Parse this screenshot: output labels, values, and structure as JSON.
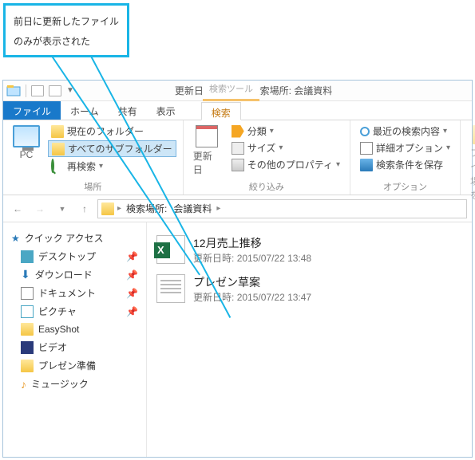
{
  "callout": {
    "line1": "前日に更新したファイル",
    "line2": "のみが表示された"
  },
  "titlebar": {
    "tools_context": "検索ツール",
    "title_prefix": "更新日時：今日 - 検索場所:",
    "title_loc": "会議資料"
  },
  "tabs": {
    "file": "ファイル",
    "home": "ホーム",
    "share": "共有",
    "view": "表示",
    "search": "検索"
  },
  "ribbon": {
    "pc": "PC",
    "current_folder": "現在のフォルダー",
    "all_subfolders": "すべてのサブフォルダー",
    "research": "再検索",
    "loc_group": "場所",
    "date": "更新日",
    "kind": "分類",
    "size": "サイズ",
    "other": "その他のプロパティ",
    "refine_group": "絞り込み",
    "recent": "最近の検索内容",
    "advanced": "詳細オプション",
    "save": "検索条件を保存",
    "opt_group": "オプション",
    "fileopen1": "ファイル",
    "fileopen2": "場所を"
  },
  "addr": {
    "label": "検索場所:",
    "loc": "会議資料"
  },
  "sidebar": {
    "quick": "クイック アクセス",
    "items": [
      "デスクトップ",
      "ダウンロード",
      "ドキュメント",
      "ピクチャ",
      "EasyShot",
      "ビデオ",
      "プレゼン準備",
      "ミュージック"
    ]
  },
  "files": [
    {
      "name": "12月売上推移",
      "meta_label": "更新日時:",
      "meta": "2015/07/22 13:48",
      "type": "xls"
    },
    {
      "name": "プレゼン草案",
      "meta_label": "更新日時:",
      "meta": "2015/07/22 13:47",
      "type": "txt"
    }
  ]
}
